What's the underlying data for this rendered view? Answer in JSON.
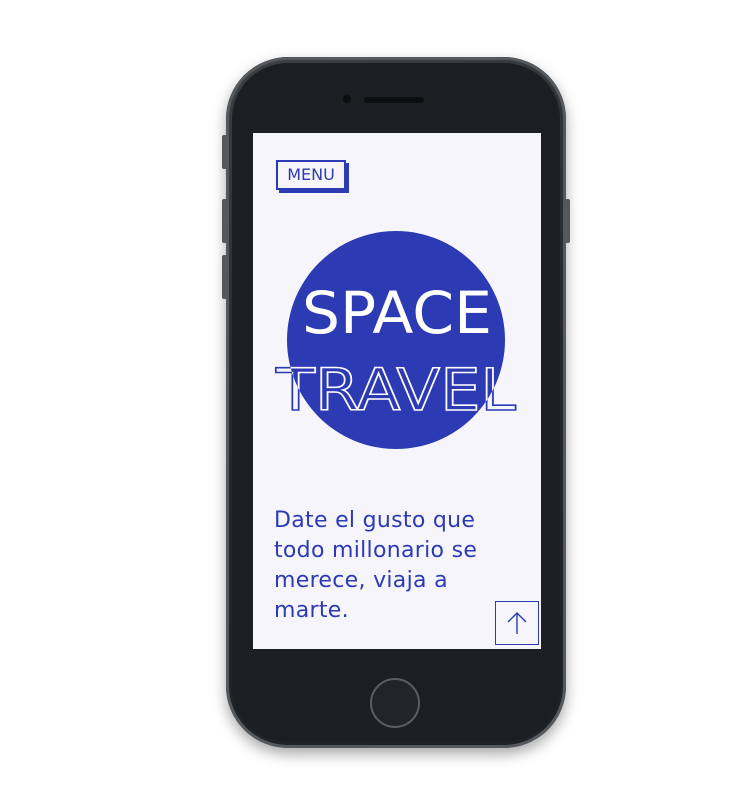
{
  "colors": {
    "accent": "#2c3ab4",
    "screen_background": "#f6f5fb",
    "page_background": "#ffffff",
    "device_body": "#26292c"
  },
  "menu": {
    "label": "MENU"
  },
  "hero": {
    "line1": "SPACE",
    "line2": "TRAVEL"
  },
  "tagline": {
    "text": "Date el gusto que todo millonario se merece, viaja a marte."
  },
  "icons": {
    "scroll_top": "arrow-up-icon"
  }
}
